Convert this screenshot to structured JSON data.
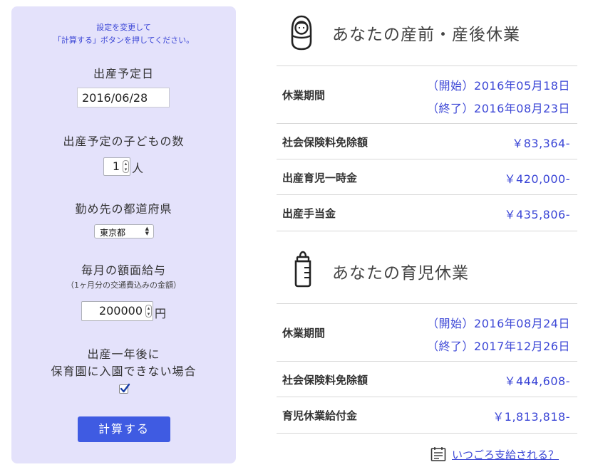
{
  "settings": {
    "instruction_line1": "設定を変更して",
    "instruction_line2": "「計算する」ボタンを押してください。",
    "due_date_label": "出産予定日",
    "due_date_value": "2016/06/28",
    "children_label": "出産予定の子どもの数",
    "children_value": "1",
    "children_unit": "人",
    "prefecture_label": "勤め先の都道府県",
    "prefecture_value": "東京都",
    "salary_label": "毎月の額面給与",
    "salary_note": "（1ヶ月分の交通費込みの金額）",
    "salary_value": "200000",
    "salary_unit": "円",
    "daycare_label_line1": "出産一年後に",
    "daycare_label_line2": "保育園に入園できない場合",
    "daycare_checked": true,
    "calculate_button": "計算する"
  },
  "maternity": {
    "title": "あなたの産前・産後休業",
    "icon": "baby-icon",
    "rows": [
      {
        "label": "休業期間",
        "start": "（開始）2016年05月18日",
        "end": "（終了）2016年08月23日"
      },
      {
        "label": "社会保険料免除額",
        "value": "￥83,364-"
      },
      {
        "label": "出産育児一時金",
        "value": "￥420,000-"
      },
      {
        "label": "出産手当金",
        "value": "￥435,806-"
      }
    ]
  },
  "childcare": {
    "title": "あなたの育児休業",
    "icon": "baby-bottle-icon",
    "rows": [
      {
        "label": "休業期間",
        "start": "（開始）2016年08月24日",
        "end": "（終了）2017年12月26日"
      },
      {
        "label": "社会保険料免除額",
        "value": "￥444,608-"
      },
      {
        "label": "育児休業給付金",
        "value": "￥1,813,818-"
      }
    ]
  },
  "footer": {
    "link_label": "いつごろ支給される？",
    "icon": "calendar-list-icon"
  },
  "colors": {
    "panel_bg": "#e4e2fb",
    "accent_blue": "#3b46d6",
    "button_blue": "#3f5be2"
  }
}
